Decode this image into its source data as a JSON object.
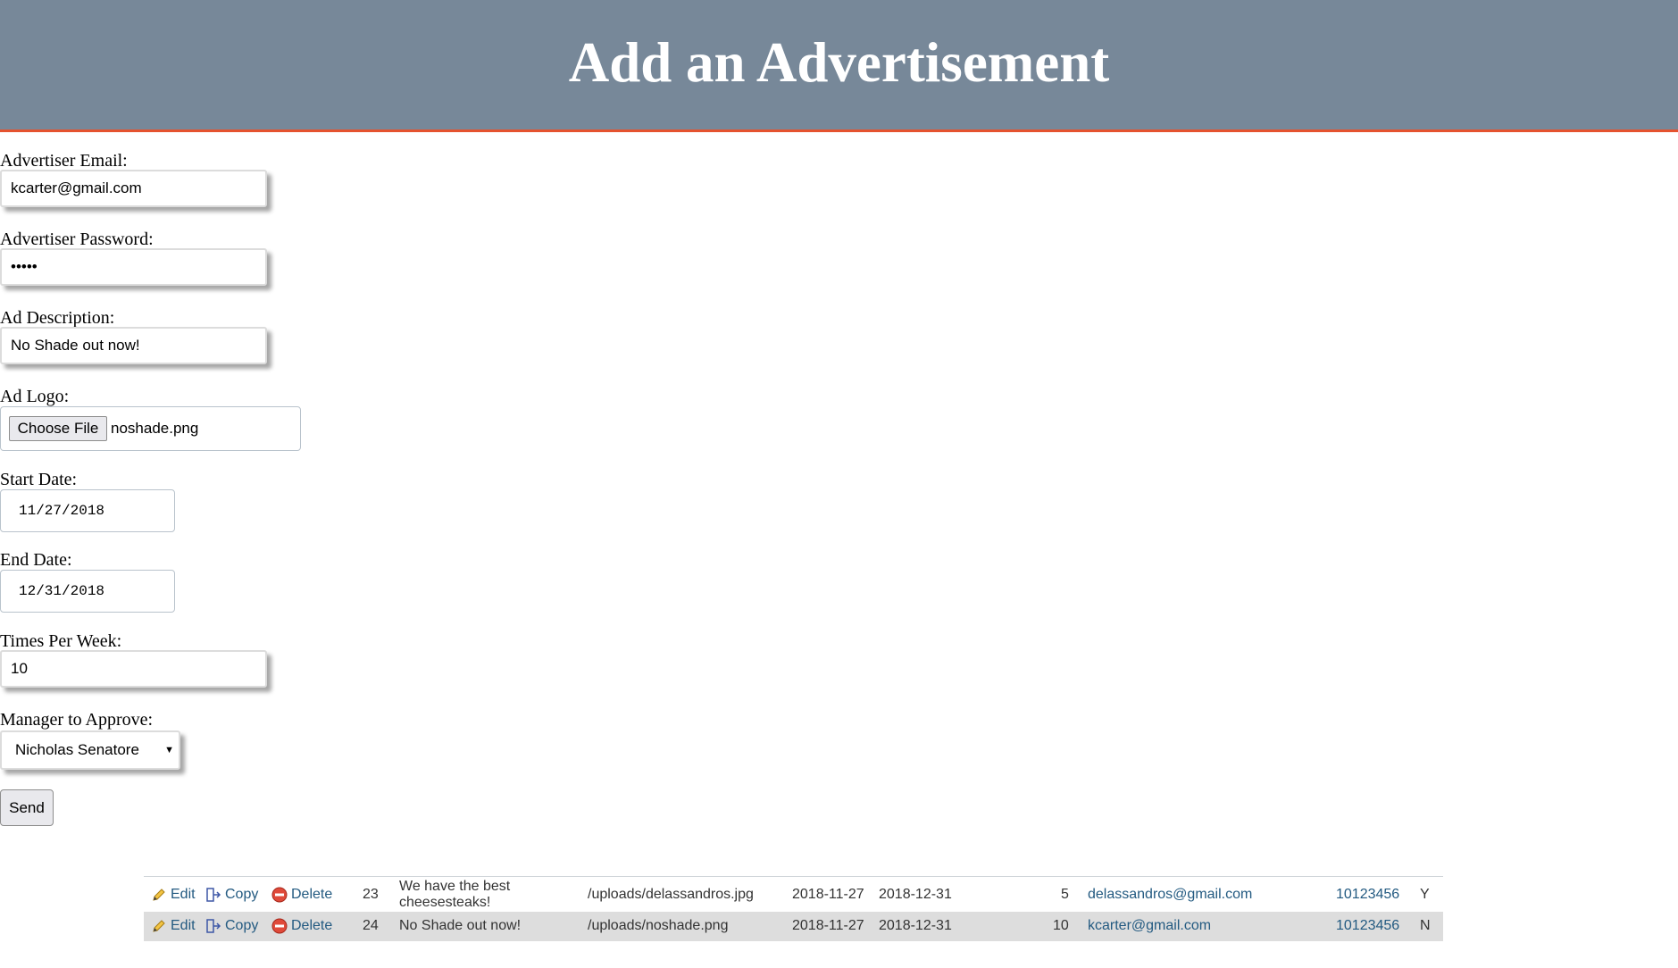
{
  "header": {
    "title": "Add an Advertisement",
    "background_color": "#778899",
    "accent_color": "#e5532f"
  },
  "form": {
    "email": {
      "label": "Advertiser Email:",
      "value": "kcarter@gmail.com"
    },
    "password": {
      "label": "Advertiser Password:",
      "value": "•••••"
    },
    "description": {
      "label": "Ad Description:",
      "value": "No Shade out now!"
    },
    "logo": {
      "label": "Ad Logo:",
      "button_label": "Choose File",
      "file_name": "noshade.png"
    },
    "start_date": {
      "label": "Start Date:",
      "value": "11/27/2018"
    },
    "end_date": {
      "label": "End Date:",
      "value": "12/31/2018"
    },
    "times_per_week": {
      "label": "Times Per Week:",
      "value": "10"
    },
    "manager": {
      "label": "Manager to Approve:",
      "selected": "Nicholas Senatore",
      "caret": "▼"
    },
    "submit_label": "Send"
  },
  "results": {
    "actions": {
      "edit": "Edit",
      "copy": "Copy",
      "delete": "Delete"
    },
    "rows": [
      {
        "id": "23",
        "description": "We have the best cheesesteaks!",
        "logo_path": "/uploads/delassandros.jpg",
        "start_date": "2018-11-27",
        "end_date": "2018-12-31",
        "times_per_week": "5",
        "email": "delassandros@gmail.com",
        "manager_id": "10123456",
        "approved": "Y"
      },
      {
        "id": "24",
        "description": "No Shade out now!",
        "logo_path": "/uploads/noshade.png",
        "start_date": "2018-11-27",
        "end_date": "2018-12-31",
        "times_per_week": "10",
        "email": "kcarter@gmail.com",
        "manager_id": "10123456",
        "approved": "N"
      }
    ]
  }
}
